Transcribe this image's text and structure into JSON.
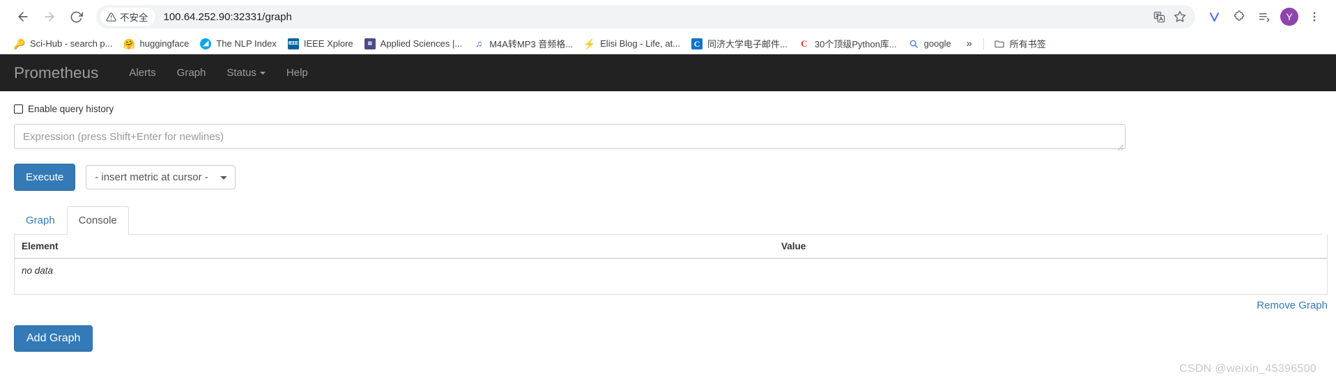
{
  "browser": {
    "nav": {
      "back_icon": "arrow-left-icon",
      "forward_icon": "arrow-right-icon",
      "reload_icon": "reload-icon"
    },
    "omnibox": {
      "security_icon": "warning-triangle-icon",
      "security_label": "不安全",
      "url": "100.64.252.90:32331/graph",
      "translate_icon": "translate-icon",
      "bookmark_icon": "star-icon"
    },
    "toolbar_icons": [
      {
        "name": "vimium-extension-icon",
        "glyph": "V"
      },
      {
        "name": "extensions-puzzle-icon",
        "glyph": "puzzle"
      },
      {
        "name": "reading-list-icon",
        "glyph": "list"
      },
      {
        "name": "profile-avatar",
        "glyph": "Y"
      },
      {
        "name": "chrome-menu-icon",
        "glyph": "⋮"
      }
    ],
    "bookmarks": [
      {
        "label": "Sci-Hub - search p...",
        "favicon": "scihub-icon",
        "glyph": "🔑"
      },
      {
        "label": "huggingface",
        "favicon": "huggingface-icon",
        "glyph": "🤗"
      },
      {
        "label": "The NLP Index",
        "favicon": "nlp-index-icon",
        "glyph": "◴"
      },
      {
        "label": "IEEE Xplore",
        "favicon": "ieee-icon",
        "glyph": "IEEE"
      },
      {
        "label": "Applied Sciences |...",
        "favicon": "mdpi-icon",
        "glyph": "▦"
      },
      {
        "label": "M4A转MP3 音频格...",
        "favicon": "music-note-icon",
        "glyph": "♫"
      },
      {
        "label": "Elisi Blog - Life, at...",
        "favicon": "elisi-icon",
        "glyph": "⚡"
      },
      {
        "label": "同济大学电子邮件...",
        "favicon": "coremail-icon",
        "glyph": "C"
      },
      {
        "label": "30个顶级Python库...",
        "favicon": "csdn-icon",
        "glyph": "C"
      },
      {
        "label": "google",
        "favicon": "search-icon",
        "glyph": "🔍"
      }
    ],
    "bookmarks_overflow_icon": "chevron-double-right-icon",
    "all_bookmarks": {
      "label": "所有书签",
      "icon": "folder-icon"
    }
  },
  "prometheus": {
    "brand": "Prometheus",
    "nav_items": [
      {
        "label": "Alerts",
        "has_caret": false
      },
      {
        "label": "Graph",
        "has_caret": false
      },
      {
        "label": "Status",
        "has_caret": true
      },
      {
        "label": "Help",
        "has_caret": false
      }
    ]
  },
  "query": {
    "history_checkbox_label": "Enable query history",
    "history_checked": false,
    "expression_value": "",
    "expression_placeholder": "Expression (press Shift+Enter for newlines)",
    "execute_label": "Execute",
    "metric_select_value": "- insert metric at cursor -"
  },
  "tabs": [
    {
      "label": "Graph",
      "active": false
    },
    {
      "label": "Console",
      "active": true
    }
  ],
  "console": {
    "columns": [
      "Element",
      "Value"
    ],
    "rows": [
      {
        "element": "no data",
        "value": ""
      }
    ],
    "remove_graph_label": "Remove Graph"
  },
  "footer": {
    "add_graph_label": "Add Graph",
    "watermark": "CSDN @weixin_45396500"
  },
  "colors": {
    "primary": "#337ab7",
    "navbar_bg": "#222222",
    "navbar_text": "#9d9d9d",
    "link": "#337ab7"
  }
}
